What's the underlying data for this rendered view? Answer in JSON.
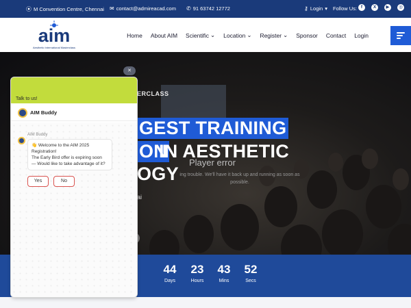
{
  "colors": {
    "brand_blue": "#1f5bd6",
    "navy": "#1a3a7a",
    "chat_green": "#c2dc3c",
    "countdown_bg": "#1f4a9a"
  },
  "topbar": {
    "address": "M Convention Centre, Chennai",
    "email": "contact@admireacad.com",
    "phone": "91 63742 12772",
    "login": "Login",
    "follow_us": "Follow Us:",
    "social_icons": [
      "facebook-icon",
      "x-icon",
      "youtube-icon",
      "instagram-icon"
    ]
  },
  "logo": {
    "text": "aim",
    "tagline": "Aesthetic International Masterclass"
  },
  "nav": {
    "items": [
      "Home",
      "About AIM",
      "Scientific",
      "Location",
      "Register",
      "Sponsor",
      "Contact",
      "Login"
    ],
    "dropdown_items": [
      "Scientific",
      "Location",
      "Register"
    ]
  },
  "hero": {
    "eyebrow": "ERCLASS",
    "line1": "GEST TRAINING",
    "line2a": "ON",
    "line2b": "IN AESTHETIC",
    "line3": "OGY",
    "location_fragment": "ai",
    "player_error": "Player error",
    "player_error_sub": "ing trouble. We'll have it back up and running as soon as possible."
  },
  "countdown": [
    {
      "value": "44",
      "label": "Days"
    },
    {
      "value": "23",
      "label": "Hours"
    },
    {
      "value": "43",
      "label": "Mins"
    },
    {
      "value": "52",
      "label": "Secs"
    }
  ],
  "chat": {
    "talk_to_us": "Talk to us!",
    "bot_name": "AIM Buddy",
    "message_sender": "AIM Buddy",
    "message_lines": [
      "👋 Welcome to the AIM 2025",
      "Registration!",
      "The Early Bird offer is expiring soon",
      "— Would like to take advantage of it?"
    ],
    "yes": "Yes",
    "no": "No",
    "close_symbol": "✕"
  }
}
